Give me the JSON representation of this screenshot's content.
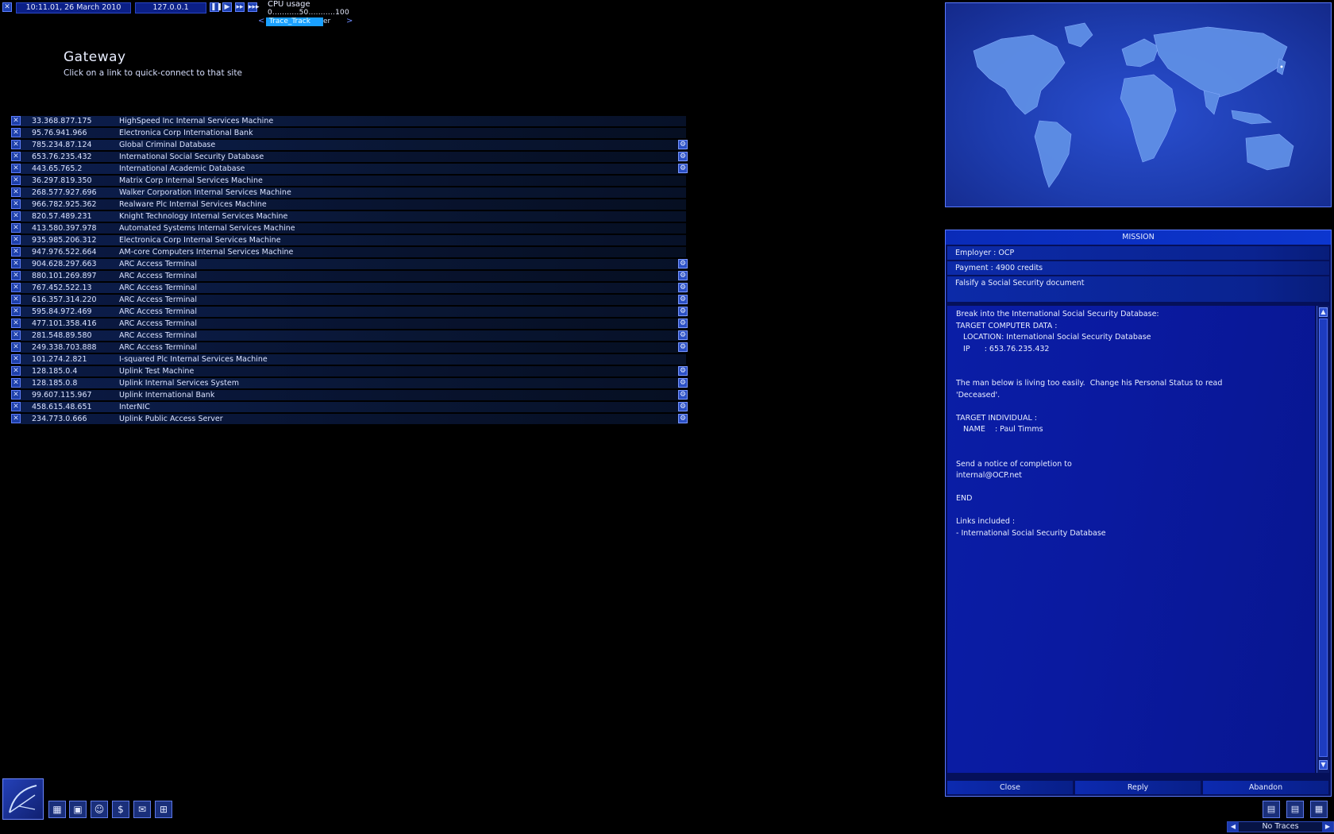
{
  "topbar": {
    "close_icon": "close-x-icon",
    "datetime": "10:11.01, 26 March 2010",
    "ip": "127.0.0.1",
    "speed_icons": [
      "pause-icon",
      "play-icon",
      "fast-forward-icon",
      "fastest-forward-icon"
    ],
    "cpu": {
      "title": "CPU usage",
      "scale": "0...........50...........100"
    },
    "tracer": {
      "left_arrow": "<",
      "label": "Trace_Track",
      "label_tail": "er",
      "right_arrow": ">"
    }
  },
  "gateway": {
    "title": "Gateway",
    "subtitle": "Click on a link to quick-connect to that site",
    "links": [
      {
        "ip": "33.368.877.175",
        "name": "HighSpeed Inc Internal Services Machine",
        "gear": false
      },
      {
        "ip": "95.76.941.966",
        "name": "Electronica Corp International Bank",
        "gear": false
      },
      {
        "ip": "785.234.87.124",
        "name": "Global Criminal Database",
        "gear": true
      },
      {
        "ip": "653.76.235.432",
        "name": "International Social Security Database",
        "gear": true
      },
      {
        "ip": "443.65.765.2",
        "name": "International Academic Database",
        "gear": true
      },
      {
        "ip": "36.297.819.350",
        "name": "Matrix Corp Internal Services Machine",
        "gear": false
      },
      {
        "ip": "268.577.927.696",
        "name": "Walker Corporation Internal Services Machine",
        "gear": false
      },
      {
        "ip": "966.782.925.362",
        "name": "Realware Plc Internal Services Machine",
        "gear": false
      },
      {
        "ip": "820.57.489.231",
        "name": "Knight Technology Internal Services Machine",
        "gear": false
      },
      {
        "ip": "413.580.397.978",
        "name": "Automated Systems Internal Services Machine",
        "gear": false
      },
      {
        "ip": "935.985.206.312",
        "name": "Electronica Corp Internal Services Machine",
        "gear": false
      },
      {
        "ip": "947.976.522.664",
        "name": "AM-core Computers Internal Services Machine",
        "gear": false
      },
      {
        "ip": "904.628.297.663",
        "name": "ARC Access Terminal",
        "gear": true
      },
      {
        "ip": "880.101.269.897",
        "name": "ARC Access Terminal",
        "gear": true
      },
      {
        "ip": "767.452.522.13",
        "name": "ARC Access Terminal",
        "gear": true
      },
      {
        "ip": "616.357.314.220",
        "name": "ARC Access Terminal",
        "gear": true
      },
      {
        "ip": "595.84.972.469",
        "name": "ARC Access Terminal",
        "gear": true
      },
      {
        "ip": "477.101.358.416",
        "name": "ARC Access Terminal",
        "gear": true
      },
      {
        "ip": "281.548.89.580",
        "name": "ARC Access Terminal",
        "gear": true
      },
      {
        "ip": "249.338.703.888",
        "name": "ARC Access Terminal",
        "gear": true
      },
      {
        "ip": "101.274.2.821",
        "name": "I-squared Plc Internal Services Machine",
        "gear": false
      },
      {
        "ip": "128.185.0.4",
        "name": "Uplink Test Machine",
        "gear": true
      },
      {
        "ip": "128.185.0.8",
        "name": "Uplink Internal Services System",
        "gear": true
      },
      {
        "ip": "99.607.115.967",
        "name": "Uplink International Bank",
        "gear": true
      },
      {
        "ip": "458.615.48.651",
        "name": "InterNIC",
        "gear": true
      },
      {
        "ip": "234.773.0.666",
        "name": "Uplink Public Access Server",
        "gear": true
      }
    ],
    "delete_icon": "close-x-icon",
    "connect_icon": "gear-icon"
  },
  "world_map": {
    "icon": "world-map"
  },
  "mission": {
    "header": "MISSION",
    "employer": "Employer : OCP",
    "payment": "Payment : 4900 credits",
    "description": "Falsify a Social Security document",
    "body_lines": [
      "Break into the International Social Security Database:",
      "TARGET COMPUTER DATA :",
      "   LOCATION: International Social Security Database",
      "   IP      : 653.76.235.432",
      "",
      "",
      "The man below is living too easily.  Change his Personal Status to read",
      "'Deceased'.",
      "",
      "TARGET INDIVIDUAL :",
      "   NAME    : Paul Timms",
      "",
      "",
      "Send a notice of completion to",
      "internal@OCP.net",
      "",
      "END",
      "",
      "Links included :",
      "- International Social Security Database"
    ],
    "buttons": {
      "close": "Close",
      "reply": "Reply",
      "abandon": "Abandon"
    }
  },
  "bottom_tools": [
    "software-icon",
    "hardware-icon",
    "personal-icon",
    "finance-icon",
    "email-icon",
    "network-icon"
  ],
  "status": {
    "traces": "No Traces",
    "icons": [
      "email-icon",
      "mission-icon",
      "computer-icon"
    ]
  }
}
